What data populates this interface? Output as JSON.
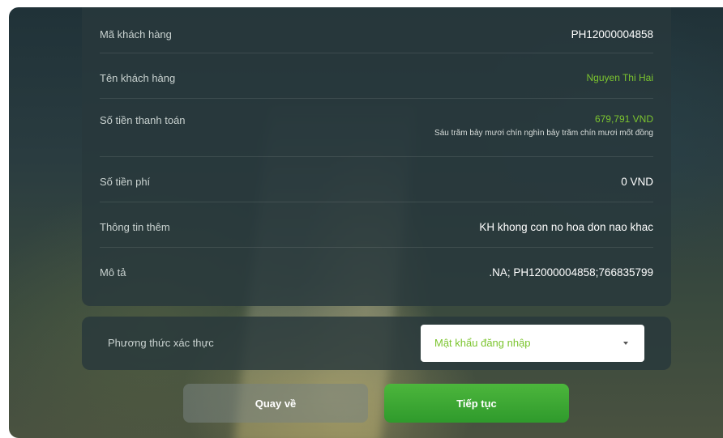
{
  "details": {
    "rows": [
      {
        "label": "Mã khách hàng",
        "value": "PH12000004858"
      },
      {
        "label": "Tên khách hàng",
        "value": "Nguyen Thi Hai"
      },
      {
        "label": "Số tiền thanh toán",
        "value": "679,791 VND",
        "sub": "Sáu trăm bảy mươi chín nghìn bảy trăm chín mươi mốt đồng"
      },
      {
        "label": "Số tiền phí",
        "value": "0 VND"
      },
      {
        "label": "Thông tin thêm",
        "value": "KH khong con no hoa don nao khac"
      },
      {
        "label": "Mô tả",
        "value": ".NA; PH12000004858;766835799"
      }
    ]
  },
  "auth": {
    "label": "Phương thức xác thực",
    "selected": "Mật khẩu đăng nhập"
  },
  "actions": {
    "back_label": "Quay về",
    "continue_label": "Tiếp tục"
  },
  "colors": {
    "accent_green": "#7cc52f",
    "button_green": "#3aa834"
  },
  "icons": {
    "select_arrow": "chevron-down-icon"
  }
}
